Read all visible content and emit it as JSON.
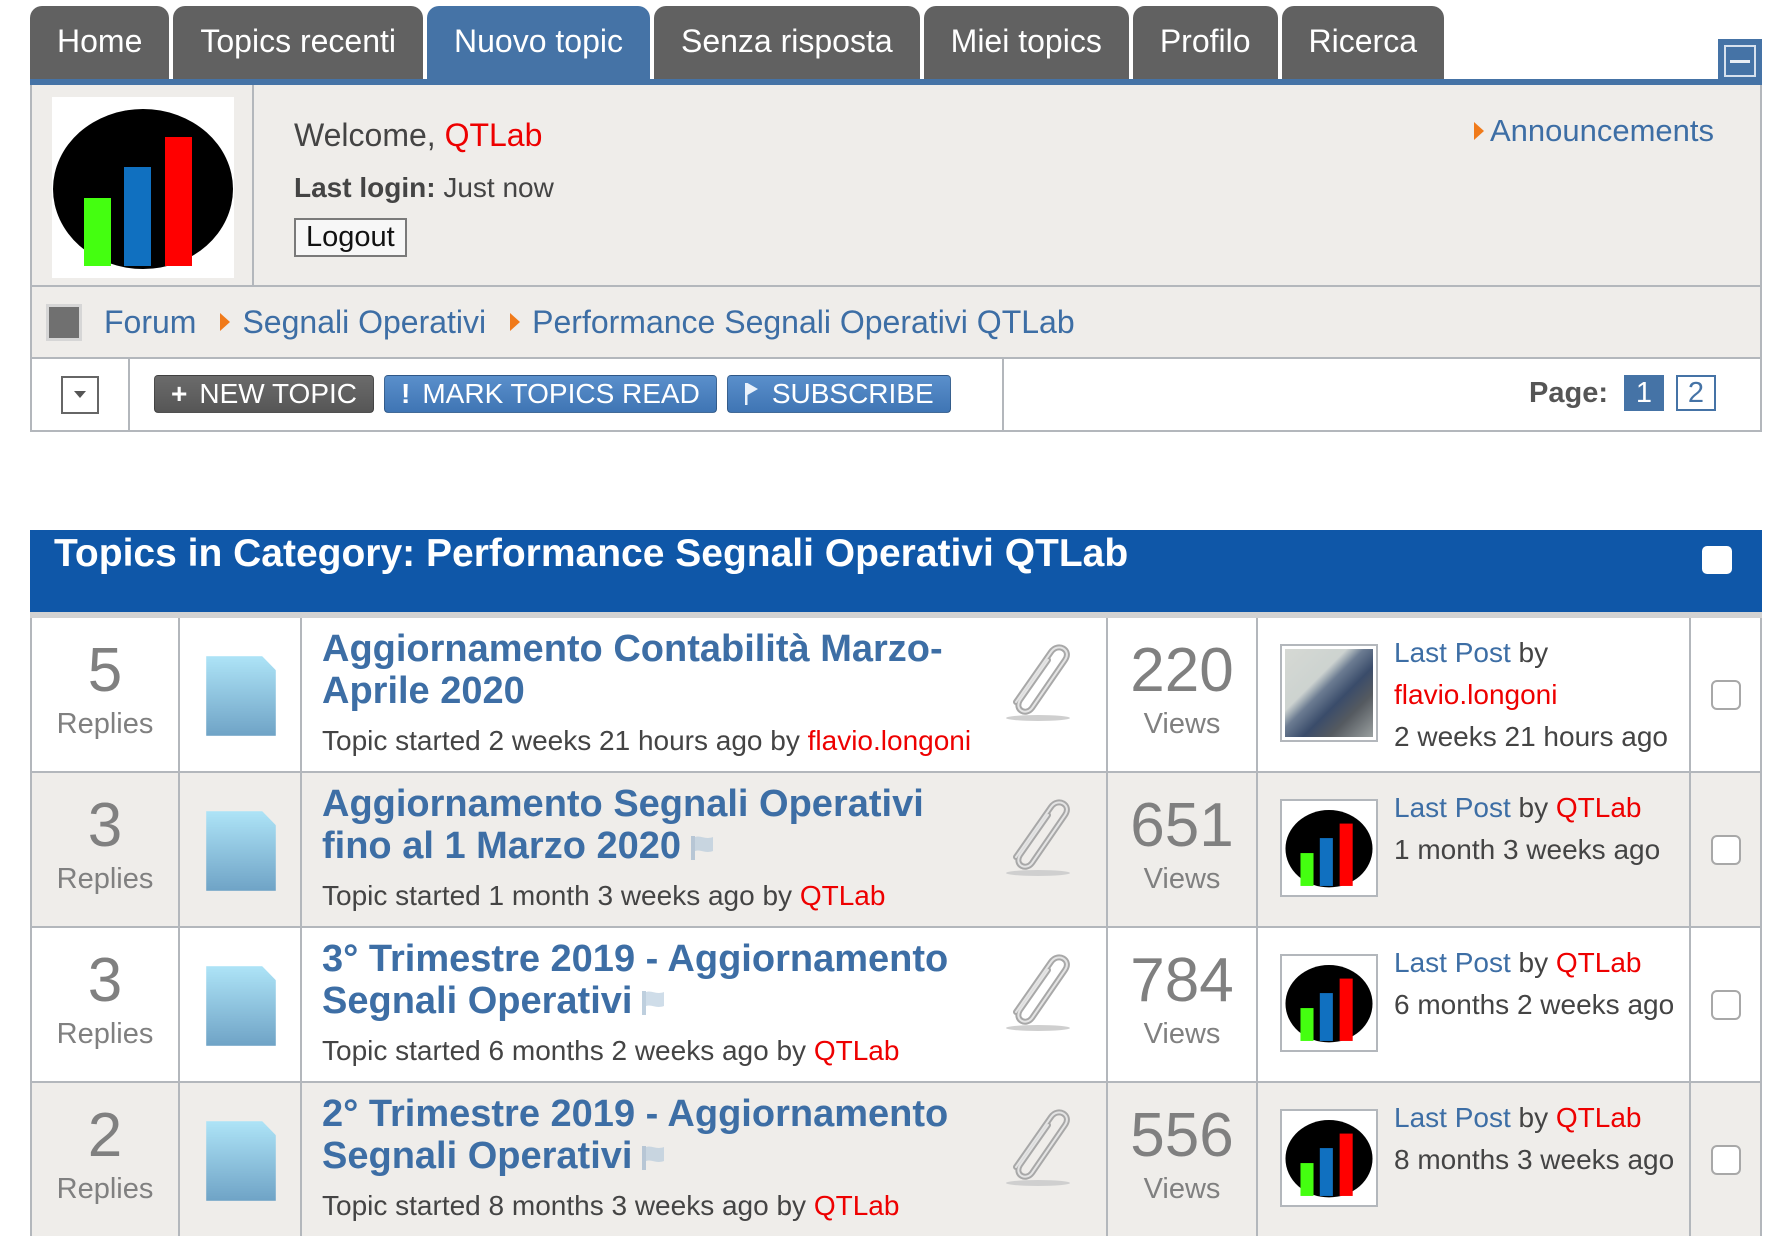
{
  "tabs": [
    {
      "label": "Home",
      "active": false
    },
    {
      "label": "Topics recenti",
      "active": false
    },
    {
      "label": "Nuovo topic",
      "active": true
    },
    {
      "label": "Senza risposta",
      "active": false
    },
    {
      "label": "Miei topics",
      "active": false
    },
    {
      "label": "Profilo",
      "active": false
    },
    {
      "label": "Ricerca",
      "active": false
    }
  ],
  "user": {
    "welcome_prefix": "Welcome,",
    "username": "QTLab",
    "last_login_label": "Last login:",
    "last_login_value": "Just now",
    "logout_label": "Logout"
  },
  "announcements_label": "Announcements",
  "breadcrumb": [
    "Forum",
    "Segnali Operativi",
    "Performance Segnali Operativi QTLab"
  ],
  "toolbar": {
    "new_topic": "NEW TOPIC",
    "mark_read": "MARK TOPICS READ",
    "subscribe": "SUBSCRIBE",
    "page_label": "Page:",
    "pages": [
      "1",
      "2"
    ],
    "current_page": "1"
  },
  "category": {
    "title": "Topics in Category: Performance Segnali Operativi QTLab"
  },
  "labels": {
    "replies": "Replies",
    "views": "Views",
    "last_post": "Last Post",
    "by": "by",
    "topic_started": "Topic started"
  },
  "colors": {
    "accent": "#4573a6",
    "header_blue": "#0f57a8",
    "author_red": "#ee0000",
    "breadcrumb_arrow": "#f07a1a"
  },
  "topics": [
    {
      "replies": "5",
      "title": "Aggiornamento Contabilità Marzo-Aprile 2020",
      "flag": false,
      "started_ago": "2 weeks 21 hours ago",
      "author": "flavio.longoni",
      "views": "220",
      "last_post_author": "flavio.longoni",
      "last_post_ago": "2 weeks 21 hours ago",
      "last_post_avatar": "photo"
    },
    {
      "replies": "3",
      "title": "Aggiornamento Segnali Operativi fino al 1 Marzo 2020",
      "flag": true,
      "started_ago": "1 month 3 weeks ago",
      "author": "QTLab",
      "views": "651",
      "last_post_author": "QTLab",
      "last_post_ago": "1 month 3 weeks ago",
      "last_post_avatar": "qtlab-logo"
    },
    {
      "replies": "3",
      "title": "3° Trimestre 2019 - Aggiornamento Segnali Operativi",
      "flag": true,
      "started_ago": "6 months 2 weeks ago",
      "author": "QTLab",
      "views": "784",
      "last_post_author": "QTLab",
      "last_post_ago": "6 months 2 weeks ago",
      "last_post_avatar": "qtlab-logo"
    },
    {
      "replies": "2",
      "title": "2° Trimestre 2019 - Aggiornamento Segnali Operativi",
      "flag": true,
      "started_ago": "8 months 3 weeks ago",
      "author": "QTLab",
      "views": "556",
      "last_post_author": "QTLab",
      "last_post_ago": "8 months 3 weeks ago",
      "last_post_avatar": "qtlab-logo"
    }
  ]
}
